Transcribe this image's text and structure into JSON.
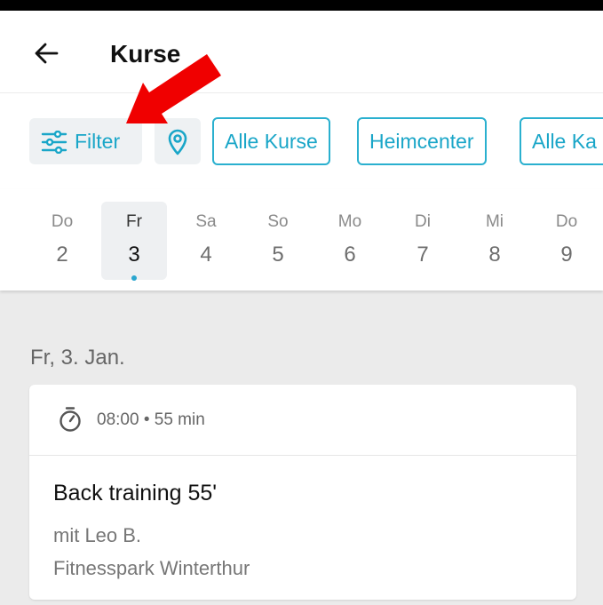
{
  "header": {
    "title": "Kurse",
    "back_icon": "arrow-left-icon"
  },
  "filters": {
    "filter_label": "Filter",
    "filter_icon": "sliders-icon",
    "location_icon": "map-pin-icon",
    "chips": [
      "Alle Kurse",
      "Heimcenter",
      "Alle Ka"
    ]
  },
  "days": [
    {
      "name": "Do",
      "num": "2"
    },
    {
      "name": "Fr",
      "num": "3"
    },
    {
      "name": "Sa",
      "num": "4"
    },
    {
      "name": "So",
      "num": "5"
    },
    {
      "name": "Mo",
      "num": "6"
    },
    {
      "name": "Di",
      "num": "7"
    },
    {
      "name": "Mi",
      "num": "8"
    },
    {
      "name": "Do",
      "num": "9"
    }
  ],
  "selected_day_index": 1,
  "date_heading": "Fr, 3. Jan.",
  "course": {
    "time": "08:00 • 55 min",
    "timer_icon": "stopwatch-icon",
    "name": "Back training 55'",
    "trainer": "mit Leo B.",
    "location": "Fitnesspark Winterthur"
  },
  "colors": {
    "accent": "#1aa6c8",
    "annotation_arrow": "#f00000"
  },
  "annotation": {
    "type": "red-arrow",
    "points_to": "filter-button"
  }
}
